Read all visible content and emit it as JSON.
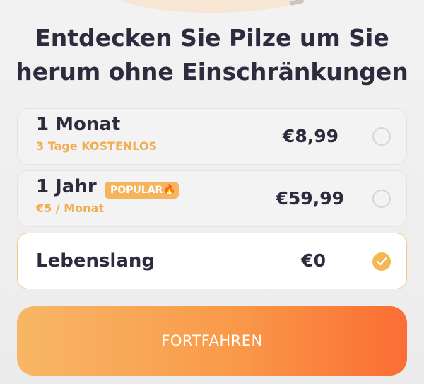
{
  "headline": {
    "line1": "Entdecken Sie Pilze um Sie",
    "line2": "herum ohne Einschränkungen"
  },
  "plans": [
    {
      "name": "1 Monat",
      "subtitle": "3 Tage KOSTENLOS",
      "price": "€8,99",
      "selected": false
    },
    {
      "name": "1 Jahr",
      "badge": "POPULAR",
      "badge_icon": "fire-icon",
      "subtitle": "€5 / Monat",
      "price": "€59,99",
      "selected": false
    },
    {
      "name": "Lebenslang",
      "price": "€0",
      "selected": true
    }
  ],
  "cta": {
    "label": "FORTFAHREN"
  },
  "colors": {
    "accent": "#f6b752",
    "subtitle": "#f2ad51",
    "text": "#2f2a3e",
    "cta_start": "#f8b766",
    "cta_end": "#fb6d33"
  }
}
